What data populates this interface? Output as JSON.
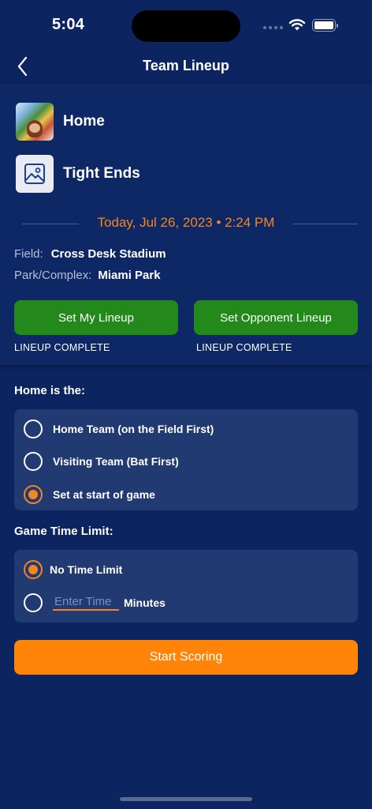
{
  "status_bar": {
    "time": "5:04"
  },
  "nav": {
    "title": "Team Lineup",
    "back_icon": "chevron-left-icon"
  },
  "teams": {
    "home": {
      "name": "Home"
    },
    "opponent": {
      "name": "Tight Ends",
      "image_icon": "image-placeholder-icon"
    }
  },
  "game": {
    "datetime": "Today, Jul 26, 2023 • 2:24 PM",
    "field_label": "Field:",
    "field_value": "Cross Desk Stadium",
    "park_label": "Park/Complex:",
    "park_value": "Miami Park"
  },
  "lineup": {
    "my_button": "Set My Lineup",
    "my_status": "LINEUP COMPLETE",
    "opponent_button": "Set Opponent Lineup",
    "opponent_status": "LINEUP COMPLETE"
  },
  "home_is": {
    "label": "Home is the:",
    "options": [
      {
        "label": "Home Team (on the Field First)",
        "selected": false
      },
      {
        "label": "Visiting Team (Bat First)",
        "selected": false
      },
      {
        "label": "Set at start of game",
        "selected": true
      }
    ]
  },
  "time_limit": {
    "label": "Game Time Limit:",
    "no_limit_label": "No Time Limit",
    "no_limit_selected": true,
    "input_placeholder": "Enter Time",
    "minutes_label": "Minutes"
  },
  "start_button": "Start Scoring",
  "colors": {
    "background": "#0c2460",
    "accent": "#f5861f",
    "green": "#22891a",
    "orange_button": "#ff8407"
  }
}
